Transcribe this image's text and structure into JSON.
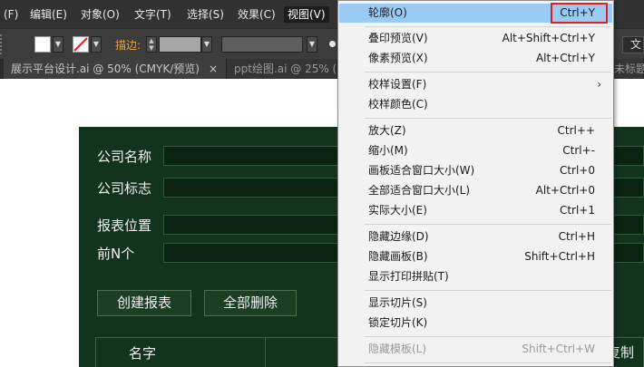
{
  "menubar": {
    "items": [
      "(F)",
      "编辑(E)",
      "对象(O)",
      "文字(T)",
      "选择(S)",
      "效果(C)",
      "视图(V)"
    ]
  },
  "ctrlbar": {
    "stroke_label": "描边:",
    "text_button": "文",
    "fill_color": "#ffffff",
    "accent_color": "#f3a32a"
  },
  "tabs": [
    {
      "label": "展示平台设计.ai @ 50% (CMYK/预览)",
      "close": "×"
    },
    {
      "label": "ppt绘图.ai @ 25% ("
    },
    {
      "label": "未标题-"
    }
  ],
  "panel": {
    "bg_color": "#13341c",
    "fields": [
      {
        "label": "公司名称"
      },
      {
        "label": "公司标志"
      },
      {
        "label": "报表位置"
      },
      {
        "label": "前N个"
      }
    ],
    "buttons": [
      "创建报表",
      "全部删除"
    ],
    "table_header": "名字",
    "trailing_text": "复制"
  },
  "view_menu": {
    "items": [
      {
        "label": "轮廓(O)",
        "shortcut": "Ctrl+Y",
        "highlighted": true
      },
      {
        "label": "叠印预览(V)",
        "shortcut": "Alt+Shift+Ctrl+Y"
      },
      {
        "label": "像素预览(X)",
        "shortcut": "Alt+Ctrl+Y"
      },
      {
        "label": "校样设置(F)",
        "submenu": "›"
      },
      {
        "label": "校样颜色(C)"
      },
      {
        "label": "放大(Z)",
        "shortcut": "Ctrl++"
      },
      {
        "label": "缩小(M)",
        "shortcut": "Ctrl+-"
      },
      {
        "label": "画板适合窗口大小(W)",
        "shortcut": "Ctrl+0"
      },
      {
        "label": "全部适合窗口大小(L)",
        "shortcut": "Alt+Ctrl+0"
      },
      {
        "label": "实际大小(E)",
        "shortcut": "Ctrl+1"
      },
      {
        "label": "隐藏边缘(D)",
        "shortcut": "Ctrl+H"
      },
      {
        "label": "隐藏画板(B)",
        "shortcut": "Shift+Ctrl+H"
      },
      {
        "label": "显示打印拼贴(T)"
      },
      {
        "label": "显示切片(S)"
      },
      {
        "label": "锁定切片(K)"
      },
      {
        "label": "隐藏模板(L)",
        "shortcut": "Shift+Ctrl+W",
        "disabled": true
      }
    ],
    "highlight_color": "#99cbf5",
    "callout_color": "#e02020"
  }
}
